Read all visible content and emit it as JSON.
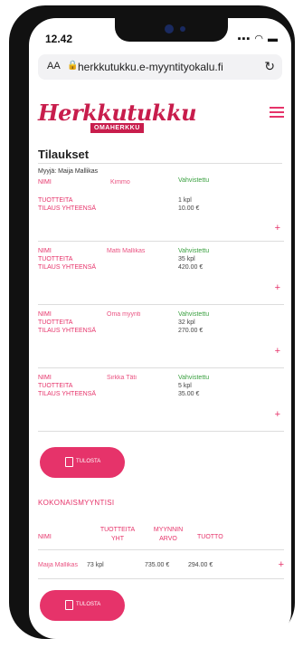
{
  "status_bar": {
    "time": "12.42",
    "icons": "▪▪▪ ◠ ▬"
  },
  "browser": {
    "aa": "AA",
    "url": "herkkutukku.e-myyntityokalu.fi"
  },
  "logo": {
    "main": "Herkkutukku",
    "sub": "OMAHERKKU"
  },
  "page": {
    "title": "Tilaukset",
    "seller": "Myyjä: Maija Mallikas"
  },
  "labels": {
    "name": "NIMI",
    "products": "TUOTTEITA",
    "total": "TILAUS YHTEENSÄ"
  },
  "orders": [
    {
      "customer": "Kimmo",
      "status": "Vahvistettu",
      "products": "1 kpl",
      "total": "10.00 €"
    },
    {
      "customer": "Matti Mallikas",
      "status": "Vahvistettu",
      "products": "35 kpl",
      "total": "420.00 €"
    },
    {
      "customer": "Oma myynti",
      "status": "Vahvistettu",
      "products": "32 kpl",
      "total": "270.00 €"
    },
    {
      "customer": "Sirkka Täti",
      "status": "Vahvistettu",
      "products": "5 kpl",
      "total": "35.00 €"
    }
  ],
  "print_label": "TULOSTA",
  "summary": {
    "title": "KOKONAISMYYNTISI",
    "headers": {
      "name": "NIMI",
      "products": "TUOTTEITA YHT",
      "sales": "MYYNNIN ARVO",
      "profit": "TUOTTO"
    },
    "row": {
      "name": "Maija Mallikas",
      "products": "73 kpl",
      "sales": "735.00 €",
      "profit": "294.00 €"
    }
  },
  "colors": {
    "accent": "#e6336a",
    "brand": "#c81d4c",
    "confirmed": "#3aa040"
  }
}
